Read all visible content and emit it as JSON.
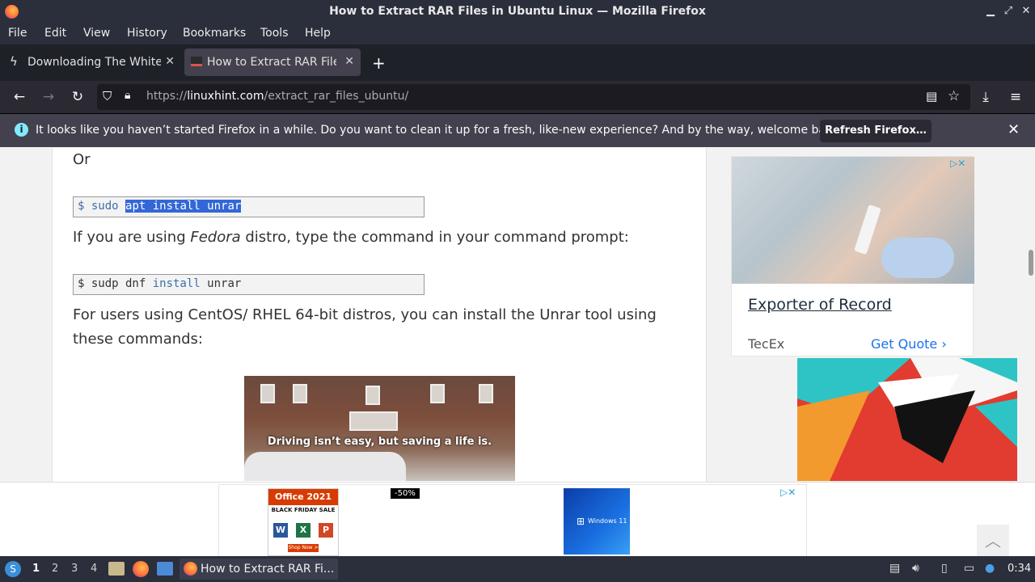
{
  "window": {
    "title": "How to Extract RAR Files in Ubuntu Linux — Mozilla Firefox",
    "buttons": [
      "minimize",
      "maximize",
      "close"
    ]
  },
  "menu": [
    "File",
    "Edit",
    "View",
    "History",
    "Bookmarks",
    "Tools",
    "Help"
  ],
  "tabs": [
    {
      "label": "Downloading The White House",
      "icon": "bolt-icon",
      "active": false
    },
    {
      "label": "How to Extract RAR Files in Ubuntu",
      "icon": "linuxhint-icon",
      "active": true
    }
  ],
  "urlbar": {
    "prefix": "https://",
    "host": "linuxhint.com",
    "path": "/extract_rar_files_ubuntu/"
  },
  "notification": {
    "message": "It looks like you haven’t started Firefox in a while. Do you want to clean it up for a fresh, like-new experience? And by the way, welcome back!",
    "button": "Refresh Firefox…"
  },
  "article": {
    "or_text": "Or",
    "code1": {
      "prompt": "$ sudo ",
      "selected": "apt install unrar"
    },
    "fedora_pre": "If you are using ",
    "fedora_em": "Fedora",
    "fedora_post": " distro, type the command in your command prompt:",
    "code2": {
      "prompt": "$ sudp dnf ",
      "kw": "install",
      "rest": " unrar"
    },
    "centos_text": "For users using CentOS/ RHEL 64-bit distros, you can install the Unrar tool using these commands:",
    "video_caption": "Driving isn’t easy, but saving a life is."
  },
  "side_ad": {
    "title": "Exporter of Record",
    "brand": "TecEx",
    "cta": "Get Quote"
  },
  "bottom_ad": {
    "office_title": "Office 2021",
    "office_sale": "BLACK FRIDAY SALE",
    "office_shop": "Shop Now >",
    "discount": "-50%",
    "windows_label": "Windows 11"
  },
  "taskbar": {
    "workspaces": [
      "1",
      "2",
      "3",
      "4"
    ],
    "active_workspace": "1",
    "task_label": "How to Extract RAR Fi...",
    "clock": "0:34"
  }
}
